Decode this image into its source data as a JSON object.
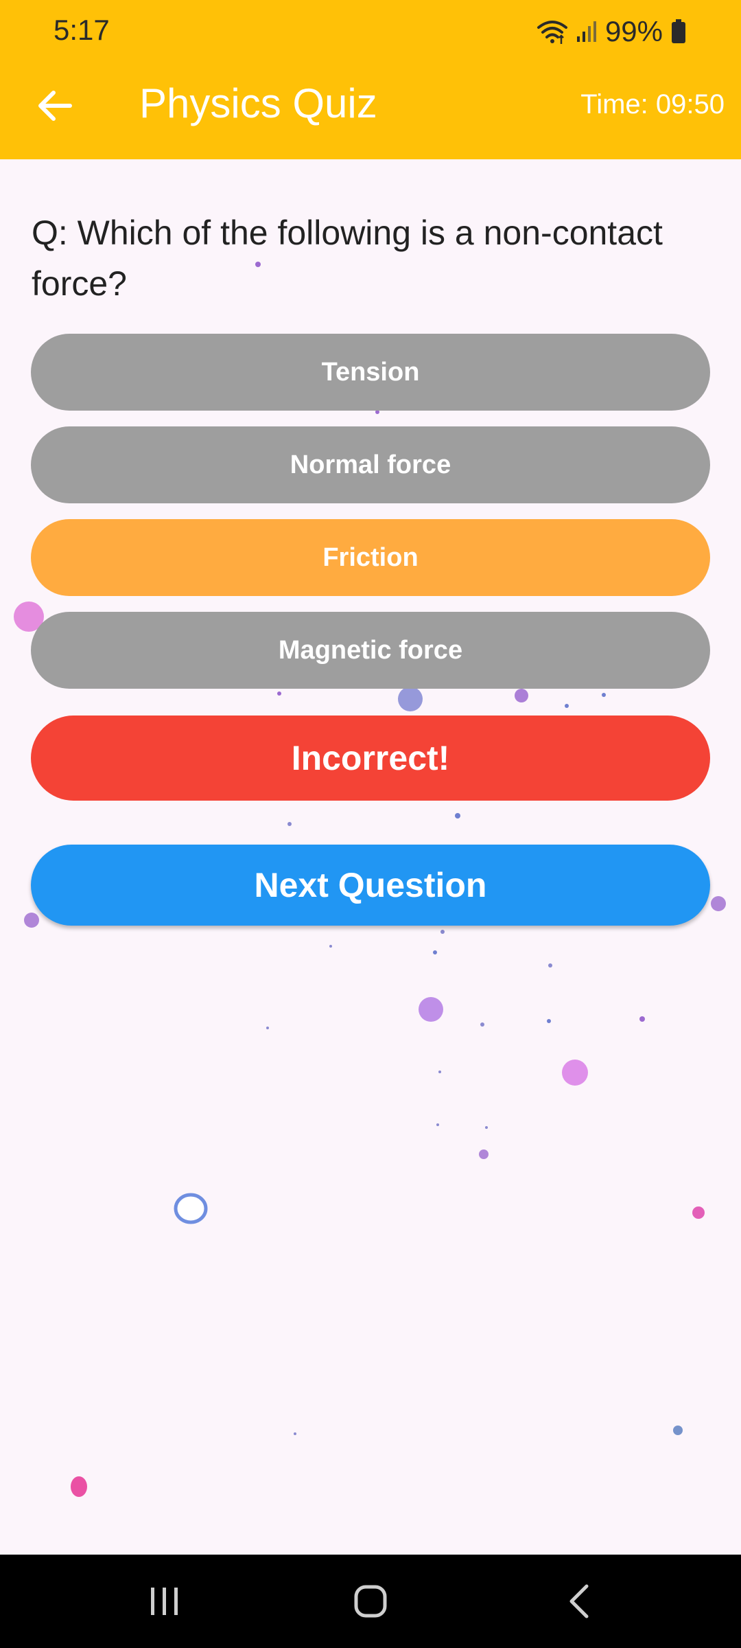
{
  "status_bar": {
    "time": "5:17",
    "battery": "99%"
  },
  "app_bar": {
    "title": "Physics Quiz",
    "timer": "Time: 09:50"
  },
  "quiz": {
    "question": "Q: Which of the following is a non-contact force?",
    "options": [
      {
        "label": "Tension",
        "state": "default"
      },
      {
        "label": "Normal force",
        "state": "default"
      },
      {
        "label": "Friction",
        "state": "selected"
      },
      {
        "label": "Magnetic force",
        "state": "default"
      }
    ],
    "result": "Incorrect!",
    "next_label": "Next Question"
  },
  "colors": {
    "app_bar": "#FFC107",
    "option_default": "#9E9E9E",
    "option_selected": "#FFAB40",
    "result_incorrect": "#F44336",
    "next_button": "#2196F3",
    "background": "#FCF5FB"
  },
  "icons": {
    "back": "arrow-back-icon",
    "wifi": "wifi-icon",
    "signal": "signal-icon",
    "battery": "battery-icon",
    "nav_recents": "recents-icon",
    "nav_home": "home-icon",
    "nav_back": "nav-back-icon"
  }
}
